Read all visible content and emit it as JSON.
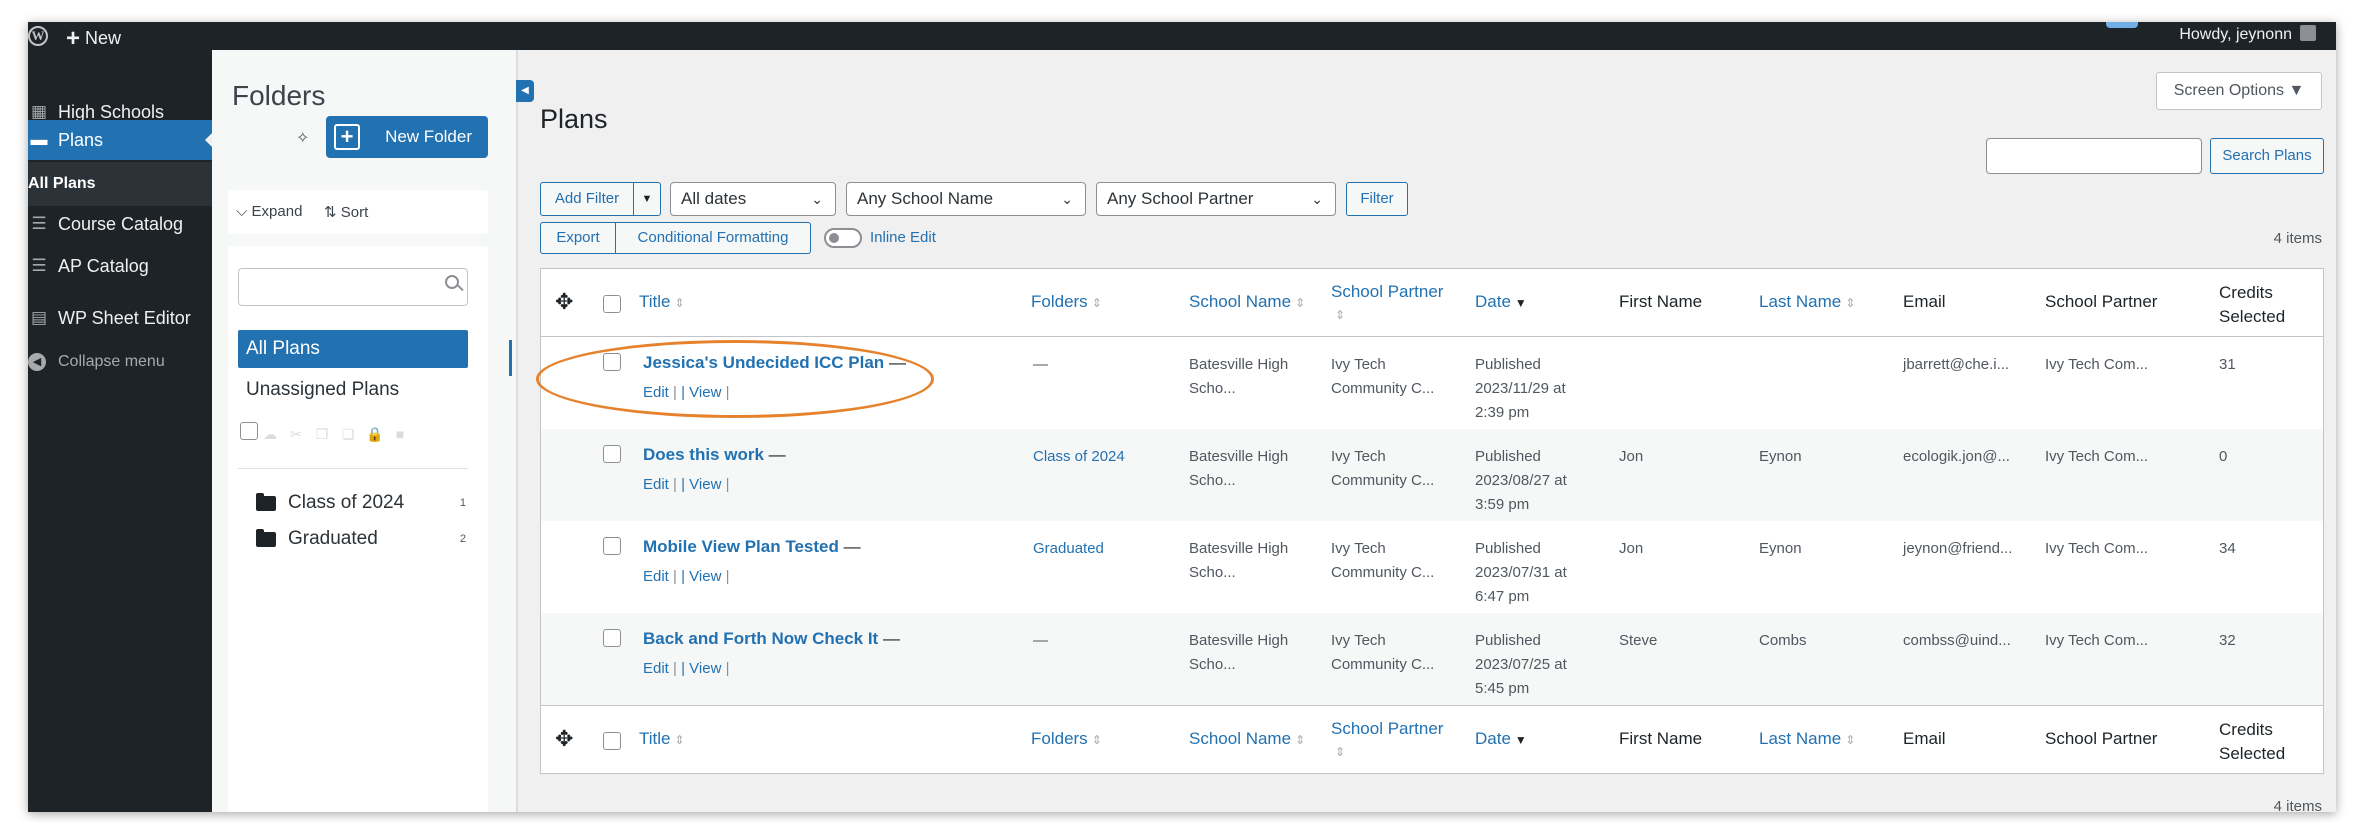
{
  "admin_bar": {
    "new_label": "New",
    "howdy": "Howdy, jeynonn"
  },
  "admin_menu": {
    "items": [
      {
        "label": "High Schools",
        "icon": "building-icon"
      },
      {
        "label": "Plans",
        "icon": "folder-icon"
      },
      {
        "label": "All Plans"
      },
      {
        "label": "Course Catalog",
        "icon": "database-icon"
      },
      {
        "label": "AP Catalog",
        "icon": "database-icon"
      },
      {
        "label": "WP Sheet Editor",
        "icon": "spreadsheet-icon"
      },
      {
        "label": "Collapse menu",
        "icon": "collapse-icon"
      }
    ]
  },
  "folders": {
    "title": "Folders",
    "new_folder_label": "New Folder",
    "expand_label": "Expand",
    "sort_label": "Sort",
    "all_plans_label": "All Plans",
    "unassigned_label": "Unassigned Plans",
    "list": [
      {
        "name": "Class of 2024",
        "count": "1"
      },
      {
        "name": "Graduated",
        "count": "2"
      }
    ]
  },
  "page": {
    "title": "Plans",
    "screen_options": "Screen Options ▼",
    "search_button": "Search Plans",
    "search_value": "",
    "items_count": "4 items"
  },
  "filters": {
    "add_filter": "Add Filter",
    "dates": "All dates",
    "school_name": "Any School Name",
    "school_partner": "Any School Partner",
    "filter_button": "Filter",
    "export": "Export",
    "conditional_formatting": "Conditional Formatting",
    "inline_edit": "Inline Edit"
  },
  "table": {
    "headers": {
      "title": "Title",
      "folders": "Folders",
      "school_name": "School Name",
      "school_partner": "School Partner",
      "date": "Date",
      "first_name": "First Name",
      "last_name": "Last Name",
      "email": "Email",
      "school_partner_2": "School Partner",
      "credits_1": "Credits",
      "credits_2": "Selected"
    },
    "row_actions": {
      "edit": "Edit",
      "view": "View"
    },
    "rows": [
      {
        "title": "Jessica's Undecided ICC Plan",
        "folder": "—",
        "school1": "Batesville High",
        "school2": "Scho...",
        "partner1": "Ivy Tech",
        "partner2": "Community C...",
        "status": "Published",
        "date": "2023/11/29 at",
        "time": "2:39 pm",
        "first": "",
        "last": "",
        "email": "jbarrett@che.i...",
        "partner_short": "Ivy Tech Com...",
        "credits": "31"
      },
      {
        "title": "Does this work",
        "folder": "Class of 2024",
        "school1": "Batesville High",
        "school2": "Scho...",
        "partner1": "Ivy Tech",
        "partner2": "Community C...",
        "status": "Published",
        "date": "2023/08/27 at",
        "time": "3:59 pm",
        "first": "Jon",
        "last": "Eynon",
        "email": "ecologik.jon@...",
        "partner_short": "Ivy Tech Com...",
        "credits": "0"
      },
      {
        "title": "Mobile View Plan Tested",
        "folder": "Graduated",
        "school1": "Batesville High",
        "school2": "Scho...",
        "partner1": "Ivy Tech",
        "partner2": "Community C...",
        "status": "Published",
        "date": "2023/07/31 at",
        "time": "6:47 pm",
        "first": "Jon",
        "last": "Eynon",
        "email": "jeynon@friend...",
        "partner_short": "Ivy Tech Com...",
        "credits": "34"
      },
      {
        "title": "Back and Forth Now Check It",
        "folder": "—",
        "school1": "Batesville High",
        "school2": "Scho...",
        "partner1": "Ivy Tech",
        "partner2": "Community C...",
        "status": "Published",
        "date": "2023/07/25 at",
        "time": "5:45 pm",
        "first": "Steve",
        "last": "Combs",
        "email": "combss@uind...",
        "partner_short": "Ivy Tech Com...",
        "credits": "32"
      }
    ]
  },
  "colors": {
    "accent": "#2271b1",
    "admin_bg": "#1d2327",
    "highlight": "#e5822b"
  }
}
